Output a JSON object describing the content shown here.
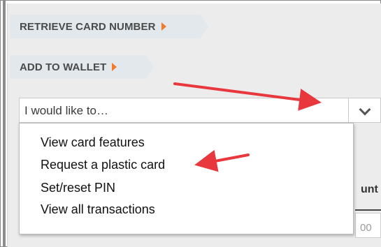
{
  "actions": {
    "retrieve_card_number": "RETRIEVE CARD NUMBER",
    "add_to_wallet": "ADD TO WALLET"
  },
  "select": {
    "value": "I would like to…"
  },
  "dropdown": {
    "options": [
      "View card features",
      "Request a plastic card",
      "Set/reset PIN",
      "View all transactions"
    ]
  },
  "background": {
    "column_header_fragment": "unt",
    "cell_fragment": "00"
  },
  "colors": {
    "caret": "#f07a28",
    "annotation_arrow": "#e8383d",
    "tag_background": "#e3e8ec",
    "panel_background": "#ececec"
  }
}
